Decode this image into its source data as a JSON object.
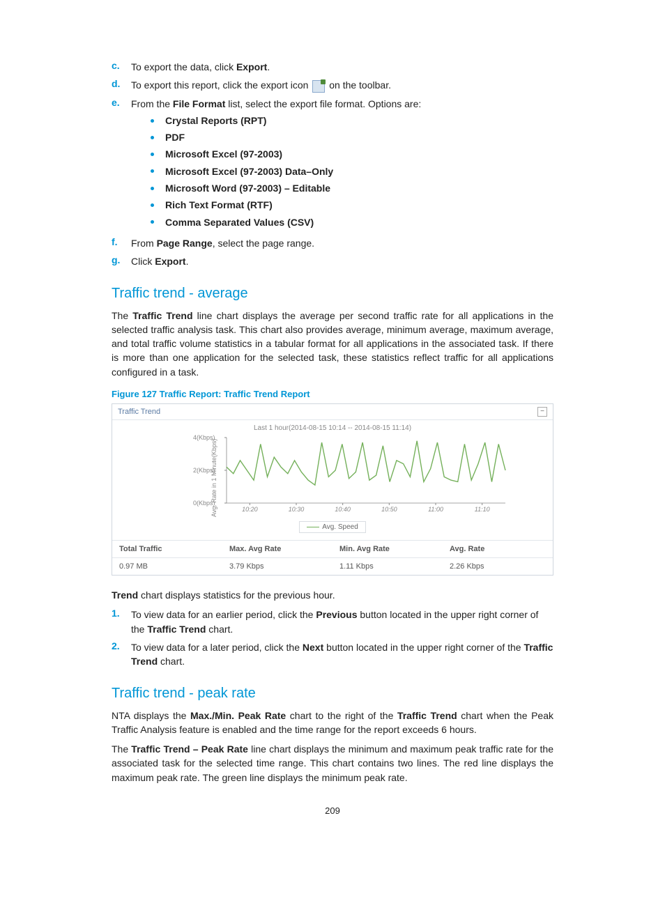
{
  "steps": {
    "c": {
      "pre": "To export the data, click ",
      "bold": "Export",
      "post": "."
    },
    "d": {
      "pre": "To export this report, click the export icon ",
      "post": " on the toolbar."
    },
    "e": {
      "pre": "From the ",
      "bold": "File Format",
      "post": " list, select the export file format. Options are:"
    },
    "f": {
      "pre": "From ",
      "bold": "Page Range",
      "post": ", select the page range."
    },
    "g": {
      "pre": "Click ",
      "bold": "Export",
      "post": "."
    }
  },
  "formats": [
    "Crystal Reports (RPT)",
    "PDF",
    "Microsoft Excel (97-2003)",
    "Microsoft Excel (97-2003) Data–Only",
    "Microsoft Word (97-2003) – Editable",
    "Rich Text Format (RTF)",
    "Comma Separated Values (CSV)"
  ],
  "section1": {
    "title": "Traffic trend - average",
    "p1a": "The ",
    "p1b": "Traffic Trend",
    "p1c": " line chart displays the average per second traffic rate for all applications in the selected traffic analysis task. This chart also provides average, minimum average, maximum average, and total traffic volume statistics in a tabular format for all applications in the associated task. If there is more than one application for the selected task, these statistics reflect traffic for all applications configured in a task."
  },
  "figcap": "Figure 127 Traffic Report: Traffic Trend Report",
  "panel": {
    "title": "Traffic Trend",
    "caption": "Last 1 hour(2014-08-15 10:14 -- 2014-08-15 11:14)",
    "ylabel": "Avg. Rate in 1 Minute(Kbps)",
    "legend": "Avg. Speed",
    "stats_h": [
      "Total Traffic",
      "Max. Avg Rate",
      "Min. Avg Rate",
      "Avg. Rate"
    ],
    "stats_v": [
      "0.97 MB",
      "3.79 Kbps",
      "1.11 Kbps",
      "2.26 Kbps"
    ]
  },
  "chart_data": {
    "type": "line",
    "title": "Traffic Trend",
    "xlabel": "",
    "ylabel": "Avg. Rate in 1 Minute(Kbps)",
    "ylim": [
      0,
      4
    ],
    "xticks": [
      "10:20",
      "10:30",
      "10:40",
      "10:50",
      "11:00",
      "11:10"
    ],
    "yticks": [
      0,
      2,
      4
    ],
    "series": [
      {
        "name": "Avg. Speed",
        "color": "#74b05a",
        "values": [
          2.2,
          1.8,
          2.6,
          2.0,
          1.4,
          3.6,
          1.6,
          2.8,
          2.2,
          1.8,
          2.6,
          1.9,
          1.4,
          1.1,
          3.7,
          1.6,
          2.0,
          3.6,
          1.5,
          1.9,
          3.7,
          1.4,
          1.7,
          3.5,
          1.3,
          2.6,
          2.4,
          1.6,
          3.8,
          1.3,
          2.1,
          3.7,
          1.6,
          1.4,
          1.3,
          3.6,
          1.4,
          2.4,
          3.7,
          1.3,
          3.6,
          2.0
        ]
      }
    ]
  },
  "after": {
    "p1a": "Trend",
    "p1b": " chart displays statistics for the previous hour.",
    "n1a": "To view data for an earlier period, click the ",
    "n1b": "Previous",
    "n1c": " button located in the upper right corner of the ",
    "n1d": "Traffic Trend",
    "n1e": " chart.",
    "n2a": "To view data for a later period, click the ",
    "n2b": "Next",
    "n2c": " button located in the upper right corner of the ",
    "n2d": "Traffic Trend",
    "n2e": " chart."
  },
  "section2": {
    "title": "Traffic trend - peak rate",
    "p1a": "NTA displays the ",
    "p1b": "Max./Min. Peak Rate",
    "p1c": " chart to the right of the ",
    "p1d": "Traffic Trend",
    "p1e": " chart when the Peak Traffic Analysis feature is enabled and the time range for the report exceeds 6 hours.",
    "p2a": "The ",
    "p2b": "Traffic Trend – Peak Rate",
    "p2c": " line chart displays the minimum and maximum peak traffic rate for the associated task for the selected time range. This chart contains two lines. The red line displays the maximum peak rate. The green line displays the minimum peak rate."
  },
  "pagenum": "209"
}
